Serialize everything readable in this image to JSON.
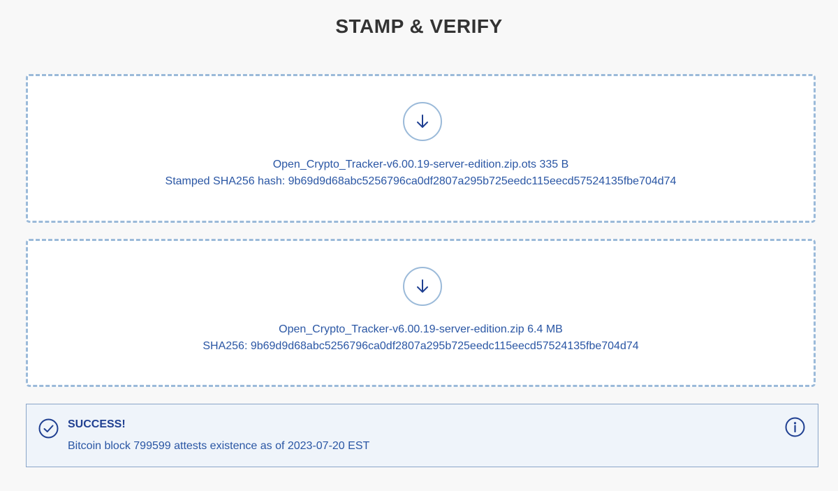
{
  "page": {
    "title": "STAMP & VERIFY"
  },
  "stamp_dropzone": {
    "icon": "arrow-down-circle-icon",
    "filename_line": "Open_Crypto_Tracker-v6.00.19-server-edition.zip.ots 335 B",
    "hash_line": "Stamped SHA256 hash: 9b69d9d68abc5256796ca0df2807a295b725eedc115eecd57524135fbe704d74"
  },
  "file_dropzone": {
    "icon": "arrow-down-circle-icon",
    "filename_line": "Open_Crypto_Tracker-v6.00.19-server-edition.zip 6.4 MB",
    "hash_line": "SHA256: 9b69d9d68abc5256796ca0df2807a295b725eedc115eecd57524135fbe704d74"
  },
  "result": {
    "icon": "check-circle-icon",
    "info_icon": "info-icon",
    "title": "SUCCESS!",
    "message": "Bitcoin block 799599 attests existence as of 2023-07-20 EST"
  },
  "colors": {
    "accent": "#2a56a4",
    "dashed_border": "#9bbad9",
    "success_title": "#1f3f91",
    "alert_bg": "#eff4fa"
  }
}
